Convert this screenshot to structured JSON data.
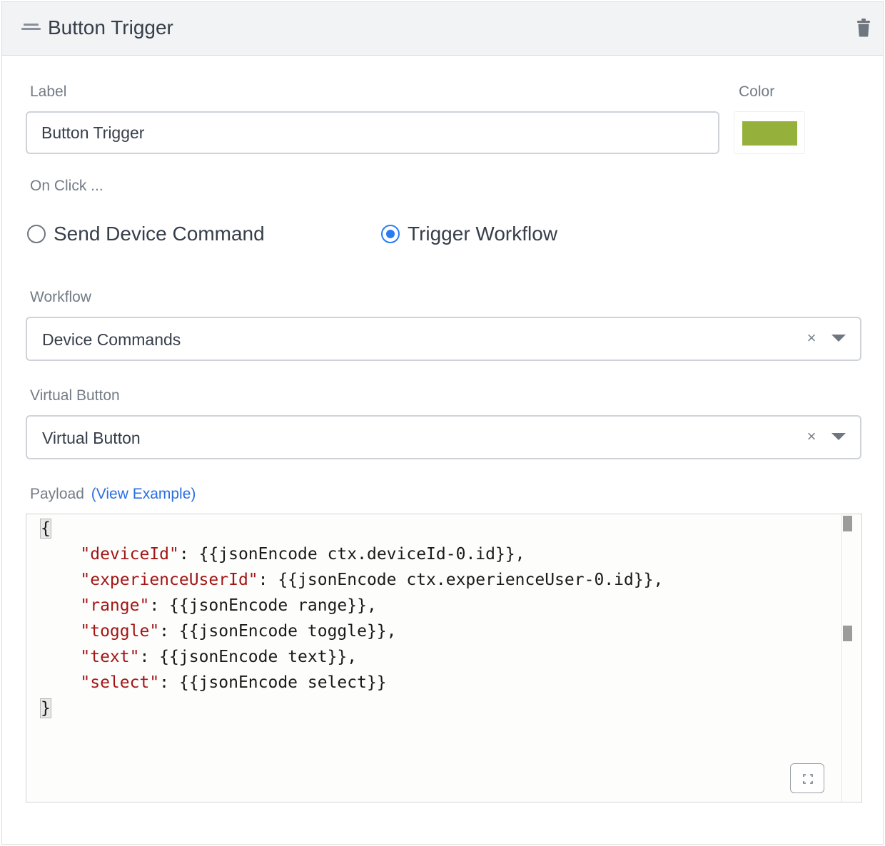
{
  "header": {
    "title": "Button Trigger",
    "drag_icon": "drag-handle-icon",
    "delete_icon": "trash-icon"
  },
  "label_field": {
    "label": "Label",
    "value": "Button Trigger"
  },
  "color_field": {
    "label": "Color",
    "value": "#95b13b"
  },
  "on_click": {
    "label": "On Click ...",
    "options": [
      {
        "label": "Send Device Command",
        "checked": false
      },
      {
        "label": "Trigger Workflow",
        "checked": true
      }
    ]
  },
  "workflow_field": {
    "label": "Workflow",
    "value": "Device Commands"
  },
  "virtual_button_field": {
    "label": "Virtual Button",
    "value": "Virtual Button"
  },
  "payload": {
    "label": "Payload",
    "link": "(View Example)",
    "lines": [
      {
        "indent": "",
        "text": "{"
      },
      {
        "indent": "    ",
        "key": "\"deviceId\"",
        "rest": ": {{jsonEncode ctx.deviceId-0.id}},"
      },
      {
        "indent": "    ",
        "key": "\"experienceUserId\"",
        "rest": ": {{jsonEncode ctx.experienceUser-0.id}},"
      },
      {
        "indent": "    ",
        "key": "\"range\"",
        "rest": ": {{jsonEncode range}},"
      },
      {
        "indent": "    ",
        "key": "\"toggle\"",
        "rest": ": {{jsonEncode toggle}},"
      },
      {
        "indent": "    ",
        "key": "\"text\"",
        "rest": ": {{jsonEncode text}},"
      },
      {
        "indent": "    ",
        "key": "\"select\"",
        "rest": ": {{jsonEncode select}}"
      },
      {
        "indent": "",
        "text": "}"
      }
    ]
  },
  "colors": {
    "accent": "#2a7cf4",
    "link": "#2a6fe0",
    "json_key": "#a31515"
  }
}
